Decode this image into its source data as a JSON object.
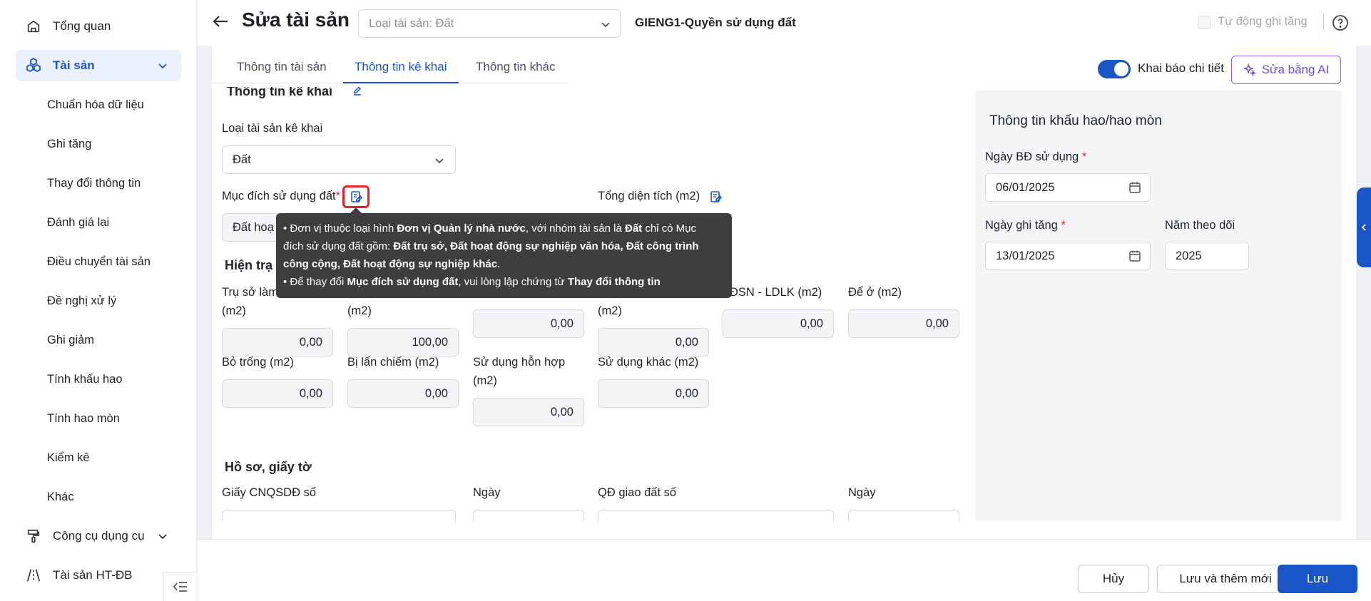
{
  "sidebar": {
    "overview": "Tổng quan",
    "assets": "Tài sản",
    "sub_items": [
      "Chuẩn hóa dữ liệu",
      "Ghi tăng",
      "Thay đổi thông tin",
      "Đánh giá lại",
      "Điều chuyển tài sản",
      "Đề nghị xử lý",
      "Ghi giảm",
      "Tính khấu hao",
      "Tính hao mòn",
      "Kiểm kê",
      "Khác"
    ],
    "tools": "Công cụ dụng cụ",
    "ht_db": "Tài sản HT-ĐB"
  },
  "header": {
    "title": "Sửa tài sản",
    "asset_type_select": "Loại tài sản: Đất",
    "asset_code": "GIENG1-Quyền sử dụng đất",
    "auto_increase": "Tự động ghi tăng"
  },
  "tabs": [
    "Thông tin tài sản",
    "Thông tin kê khai",
    "Thông tin khác"
  ],
  "toolbar": {
    "detail_toggle": "Khai báo chi tiết",
    "ai_edit": "Sửa bằng AI"
  },
  "declaration": {
    "section_title": "Thông tin kê khai",
    "type_label": "Loại tài sản kê khai",
    "type_value": "Đất",
    "purpose_label": "Mục đích sử dụng đất",
    "purpose_value": "Đất hoạ",
    "total_area_label": "Tổng diện tích (m2)"
  },
  "status": {
    "section_title": "Hiện trạ",
    "fields": [
      {
        "label": "Trụ sở làm",
        "label2": "(m2)",
        "value": "0,00"
      },
      {
        "label": "",
        "label2": "(m2)",
        "value": "100,00"
      },
      {
        "label": "",
        "label2": "",
        "value": "0,00"
      },
      {
        "label": "",
        "label2": "(m2)",
        "value": "0,00"
      },
      {
        "label": "ĐSN - LDLK (m2)",
        "label2": "",
        "value": "0,00"
      },
      {
        "label": "Để ở (m2)",
        "label2": "",
        "value": "0,00"
      },
      {
        "label": "Bỏ trống (m2)",
        "label2": "",
        "value": "0,00"
      },
      {
        "label": "Bị lấn chiếm (m2)",
        "label2": "",
        "value": "0,00"
      },
      {
        "label": "Sử dụng hỗn hợp",
        "label2": "(m2)",
        "value": "0,00"
      },
      {
        "label": "Sử dụng khác (m2)",
        "label2": "",
        "value": "0,00"
      }
    ]
  },
  "documents": {
    "section_title": "Hồ sơ, giấy tờ",
    "cert_label": "Giấy CNQSDĐ số",
    "date_label": "Ngày",
    "decision_label": "QĐ giao đất số",
    "date2_label": "Ngày"
  },
  "depreciation": {
    "title": "Thông tin khấu hao/hao mòn",
    "start_date_label": "Ngày BĐ sử dụng",
    "start_date": "06/01/2025",
    "increase_date_label": "Ngày ghi tăng",
    "increase_date": "13/01/2025",
    "track_year_label": "Năm theo dõi",
    "track_year": "2025"
  },
  "tooltip": {
    "l1a": "• Đơn vị thuộc loại hình ",
    "l1b": "Đơn vị Quản lý nhà nước",
    "l1c": ", với nhóm tài sản là ",
    "l1d": "Đất",
    "l1e": " chỉ có Mục",
    "l2a": "đích sử dụng đất gồm: ",
    "l2b": "Đất trụ sở, Đất hoạt động sự nghiệp văn hóa, Đất công trình",
    "l3a": "công cộng, Đất hoạt động sự nghiệp khác",
    "l3b": ".",
    "l4a": "• Để thay đổi ",
    "l4b": "Mục đích sử dụng đất",
    "l4c": ", vui lòng lập chứng từ ",
    "l4d": "Thay đổi thông tin"
  },
  "footer": {
    "cancel": "Hủy",
    "save_new": "Lưu và thêm mới",
    "save": "Lưu"
  }
}
